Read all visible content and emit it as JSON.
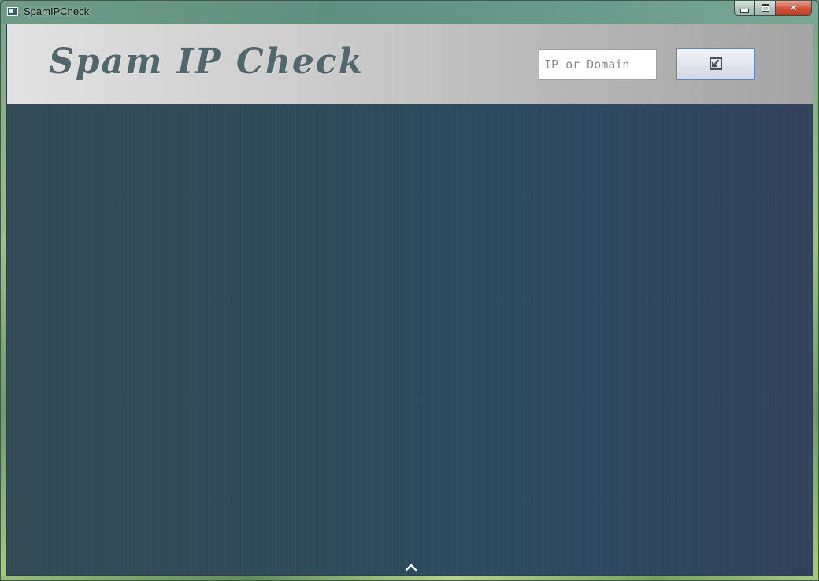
{
  "window": {
    "title": "SpamIPCheck",
    "icon": "window-app-icon",
    "controls": [
      "minimize-icon",
      "maximize-icon",
      "close-icon"
    ]
  },
  "header": {
    "title": "Spam IP Check",
    "search": {
      "value": "",
      "placeholder": "IP or Domain"
    },
    "submit_icon": "arrow-into-box-icon"
  },
  "footer": {
    "toggle_icon": "chevron-up-icon"
  },
  "colors": {
    "header_start": "#e2e2e2",
    "header_end": "#a5a5a5",
    "title_color": "#51676e",
    "panel_start": "#334a55",
    "panel_end": "#31405a",
    "button_border": "#5b86c6"
  }
}
